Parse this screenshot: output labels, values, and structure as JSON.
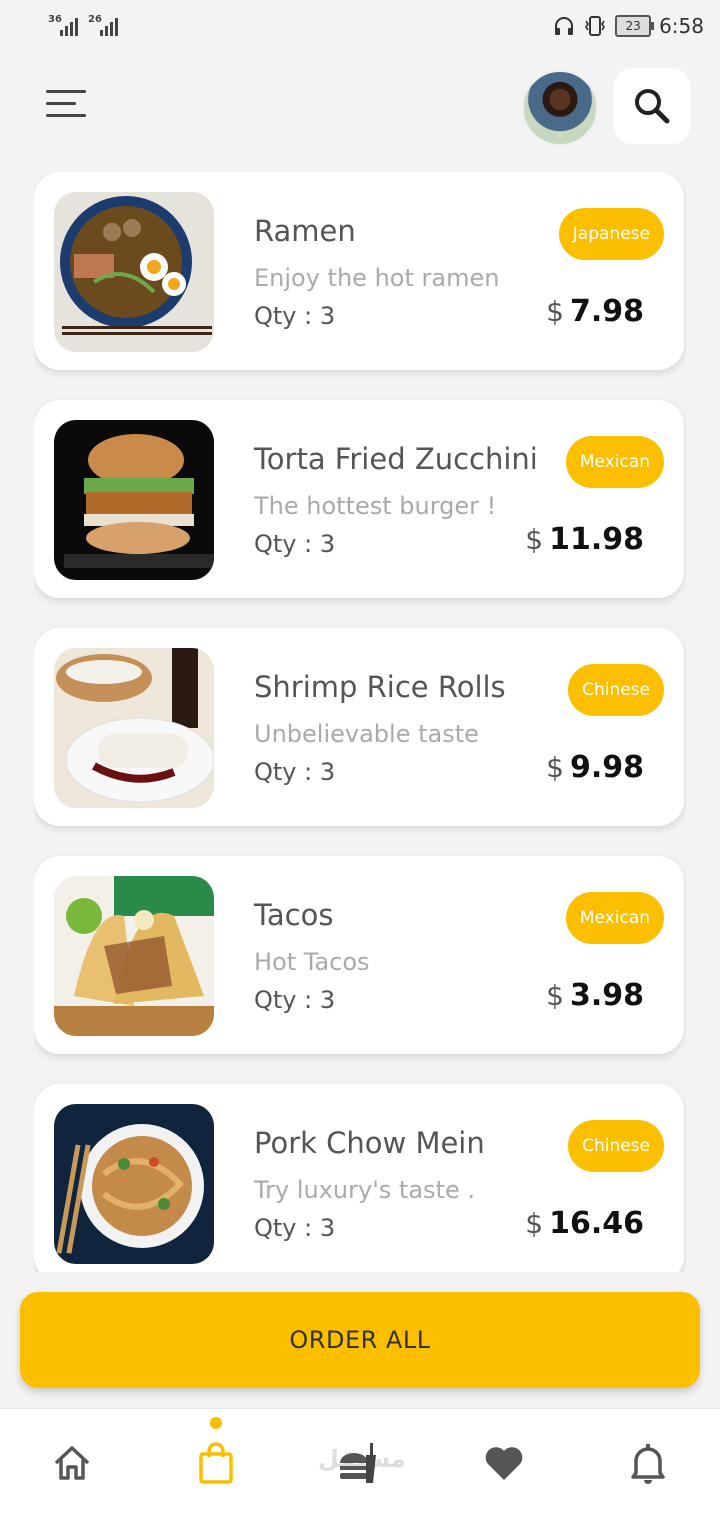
{
  "status_bar": {
    "signal_1": "36",
    "signal_2": "26",
    "battery": "23",
    "time": "6:58"
  },
  "header": {
    "menu_icon": "hamburger-menu-icon",
    "search_icon": "search-icon"
  },
  "items": [
    {
      "name": "Ramen",
      "description": "Enjoy the hot ramen",
      "qty": "Qty : 3",
      "tag": "Japanese",
      "currency": "$",
      "price": "7.98"
    },
    {
      "name": "Torta Fried Zucchini",
      "description": "The hottest burger !",
      "qty": "Qty : 3",
      "tag": "Mexican",
      "currency": "$",
      "price": "11.98"
    },
    {
      "name": "Shrimp Rice Rolls",
      "description": "Unbelievable taste",
      "qty": "Qty : 3",
      "tag": "Chinese",
      "currency": "$",
      "price": "9.98"
    },
    {
      "name": "Tacos",
      "description": "Hot Tacos",
      "qty": "Qty : 3",
      "tag": "Mexican",
      "currency": "$",
      "price": "3.98"
    },
    {
      "name": "Pork Chow Mein",
      "description": "Try luxury's taste .",
      "qty": "Qty : 3",
      "tag": "Chinese",
      "currency": "$",
      "price": "16.46"
    }
  ],
  "order_button": "ORDER ALL",
  "bottom_nav": {
    "items": [
      "home-icon",
      "shopping-bag-icon",
      "food-icon",
      "heart-icon",
      "bell-icon"
    ],
    "active": "shopping-bag-icon",
    "watermark": "مستقل"
  },
  "colors": {
    "accent": "#fcbf00",
    "background": "#f3f3f3",
    "card": "#ffffff"
  }
}
